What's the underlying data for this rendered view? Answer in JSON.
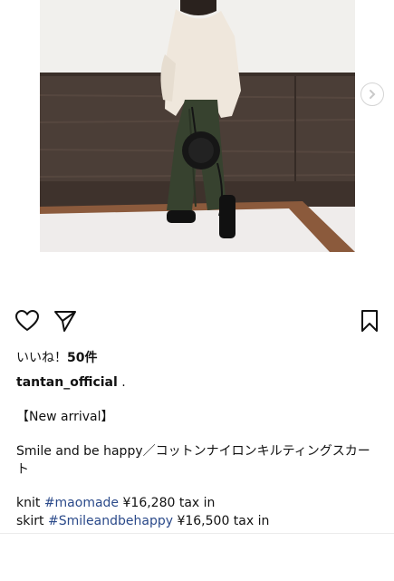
{
  "post": {
    "image_alt": "woman in cream knit, dark green skirt and black round bag",
    "likes_label": "いいね！",
    "likes_count": "50件",
    "username": "tantan_official",
    "username_suffix": " .",
    "caption_header": "【New arrival】",
    "caption_title_line1": "Smile and be happy／コットンナイロンキルティングスカー",
    "caption_title_line2": "ト",
    "items": [
      {
        "label": "knit",
        "tag": "#maomade",
        "price": "¥16,280 tax in"
      },
      {
        "label": "skirt",
        "tag": "#Smileandbehappy",
        "price": "¥16,500 tax in"
      }
    ]
  },
  "icons": {
    "like": "heart-outline-icon",
    "share": "paper-plane-icon",
    "save": "bookmark-outline-icon",
    "next": "chevron-right-icon"
  }
}
